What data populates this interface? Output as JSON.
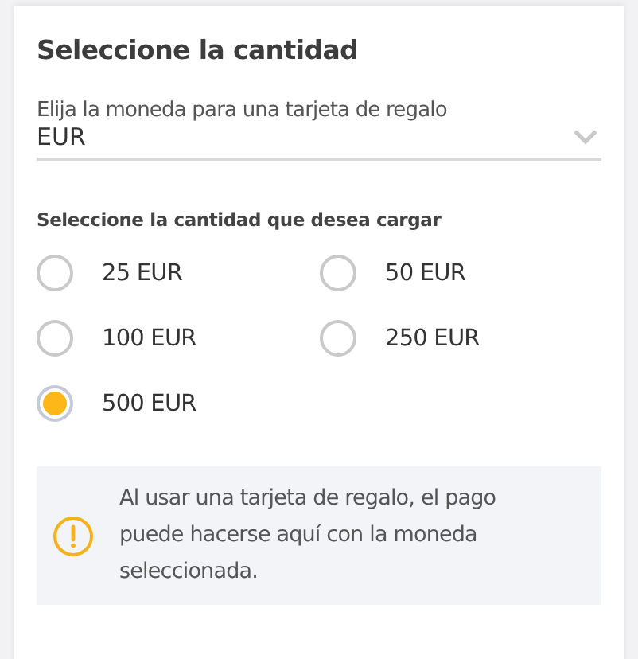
{
  "title": "Seleccione la cantidad",
  "currency": {
    "label": "Elija la moneda para una tarjeta de regalo",
    "value": "EUR"
  },
  "amount_heading": "Seleccione la cantidad que desea cargar",
  "amounts": [
    {
      "label": "25 EUR",
      "selected": false
    },
    {
      "label": "50 EUR",
      "selected": false
    },
    {
      "label": "100 EUR",
      "selected": false
    },
    {
      "label": "250 EUR",
      "selected": false
    },
    {
      "label": "500 EUR",
      "selected": true
    }
  ],
  "notice": "Al usar una tarjeta de regalo, el pago puede hacerse aquí con la moneda seleccionada."
}
